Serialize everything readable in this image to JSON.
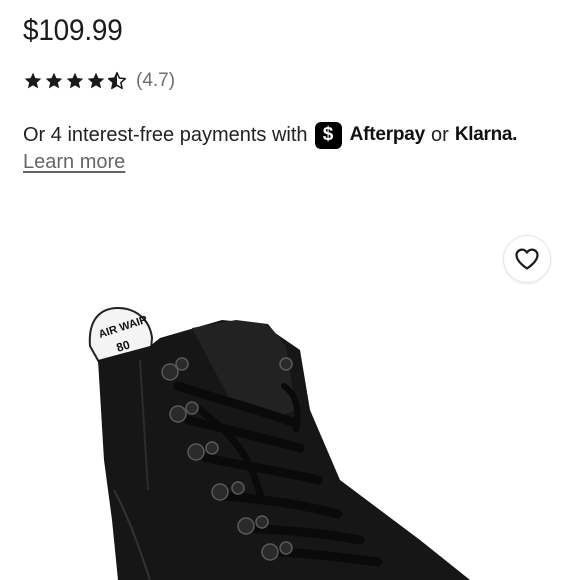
{
  "product": {
    "price": "$109.99",
    "rating_value": "(4.7)",
    "rating_stars": 4.7
  },
  "payment": {
    "text": "Or 4 interest-free payments with",
    "afterpay_badge": "$",
    "afterpay_label": "Afterpay",
    "or_text": "or",
    "klarna_label": "Klarna."
  },
  "links": {
    "learn_more": "Learn more"
  },
  "image": {
    "logo_text": "AIR WAIR",
    "number_text": "80"
  },
  "icons": {
    "star": "star-icon",
    "favorite": "heart-icon"
  },
  "colors": {
    "text": "#1b1b1b",
    "muted": "#6d6d6d",
    "brand_afterpay": "#000000"
  }
}
